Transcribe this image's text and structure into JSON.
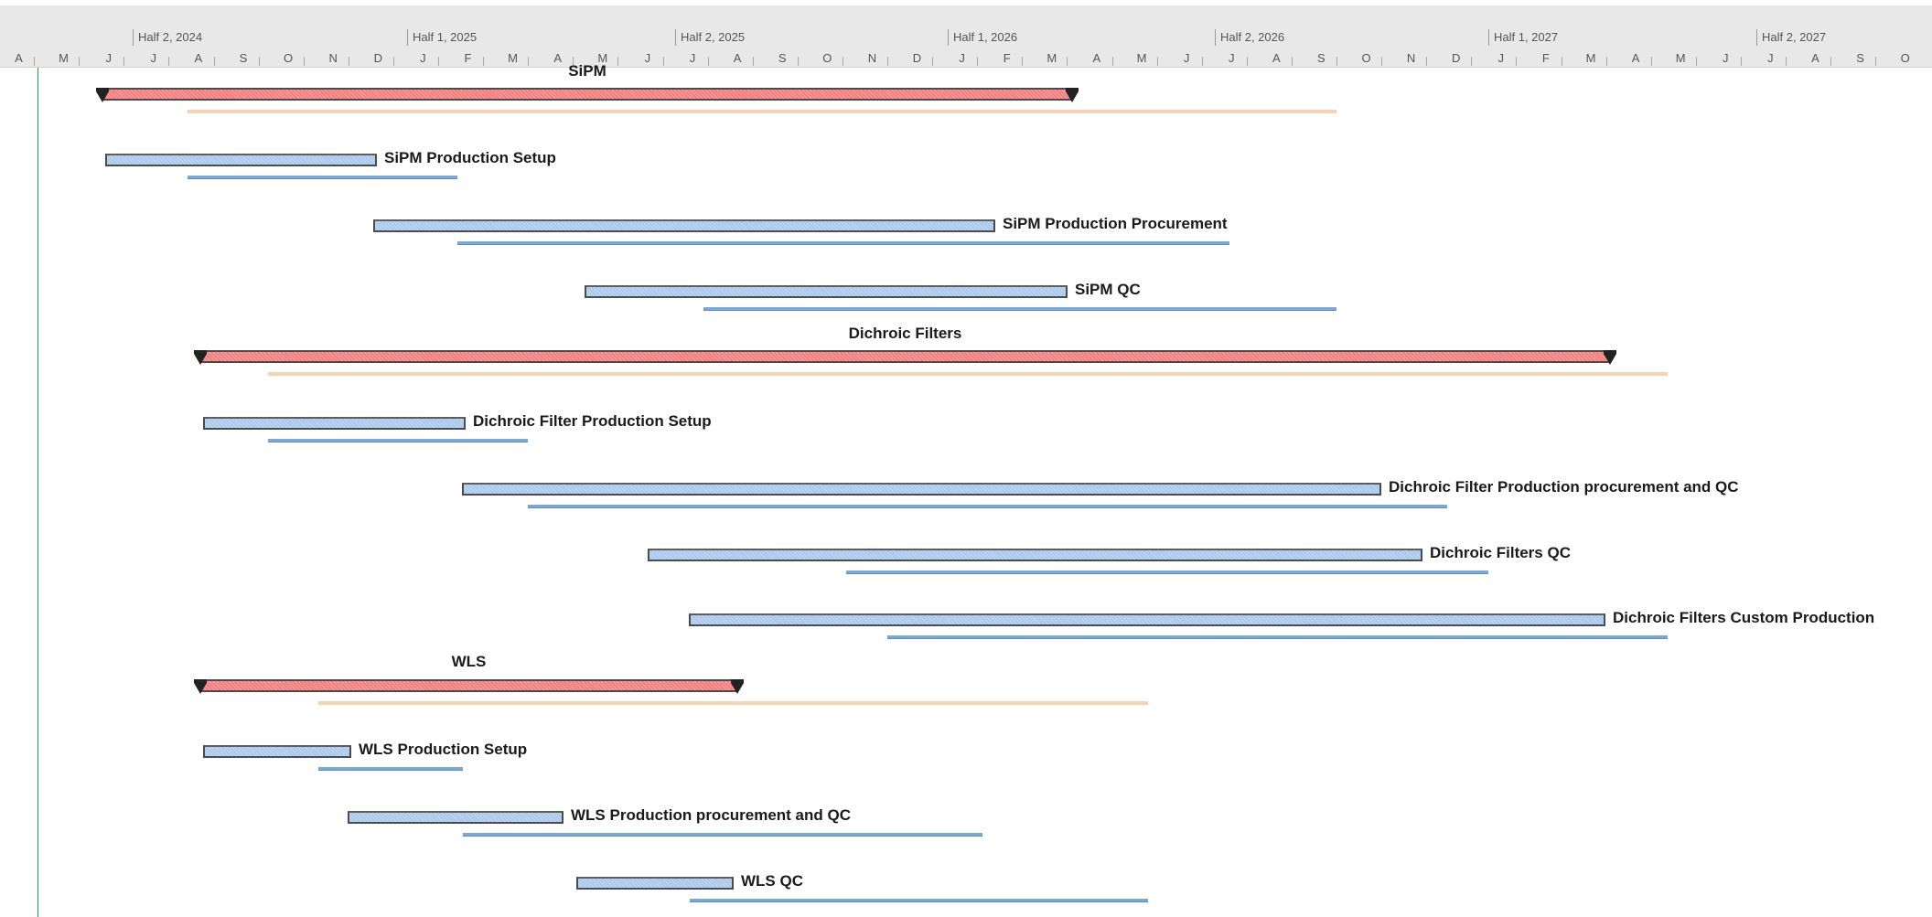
{
  "timescale": {
    "halves": [
      "Half 2, 2024",
      "Half 1, 2025",
      "Half 2, 2025",
      "Half 1, 2026",
      "Half 2, 2026",
      "Half 1, 2027",
      "Half 2, 2027"
    ],
    "months": [
      "A",
      "M",
      "J",
      "J",
      "A",
      "S",
      "O",
      "N",
      "D",
      "J",
      "F",
      "M",
      "A",
      "M",
      "J",
      "J",
      "A",
      "S",
      "O",
      "N",
      "D",
      "J",
      "F",
      "M",
      "A",
      "M",
      "J",
      "J",
      "A",
      "S",
      "O",
      "N",
      "D",
      "J",
      "F",
      "M",
      "A",
      "M",
      "J",
      "J",
      "A",
      "S",
      "O"
    ]
  },
  "colors": {
    "summary_bar": "#f77d7d",
    "task_bar": "#a9c9ec",
    "summary_baseline": "#f9d1b3",
    "task_baseline": "#7aa9d9",
    "today_line": "#1f9d55",
    "header_bg": "#e8e8e8"
  },
  "tasks": [
    {
      "name": "SiPM",
      "type": "summary",
      "label_pos": "above"
    },
    {
      "name": "SiPM Production Setup",
      "type": "task",
      "label_pos": "right"
    },
    {
      "name": "SiPM Production Procurement",
      "type": "task",
      "label_pos": "right"
    },
    {
      "name": "SiPM QC",
      "type": "task",
      "label_pos": "right"
    },
    {
      "name": "Dichroic Filters",
      "type": "summary",
      "label_pos": "above"
    },
    {
      "name": "Dichroic Filter Production Setup",
      "type": "task",
      "label_pos": "right"
    },
    {
      "name": "Dichroic Filter Production procurement and QC",
      "type": "task",
      "label_pos": "right"
    },
    {
      "name": "Dichroic Filters QC",
      "type": "task",
      "label_pos": "right"
    },
    {
      "name": "Dichroic Filters Custom Production",
      "type": "task",
      "label_pos": "right"
    },
    {
      "name": "WLS",
      "type": "summary",
      "label_pos": "above"
    },
    {
      "name": "WLS Production Setup",
      "type": "task",
      "label_pos": "right"
    },
    {
      "name": "WLS Production procurement and QC",
      "type": "task",
      "label_pos": "right"
    },
    {
      "name": "WLS QC",
      "type": "task",
      "label_pos": "right"
    }
  ]
}
